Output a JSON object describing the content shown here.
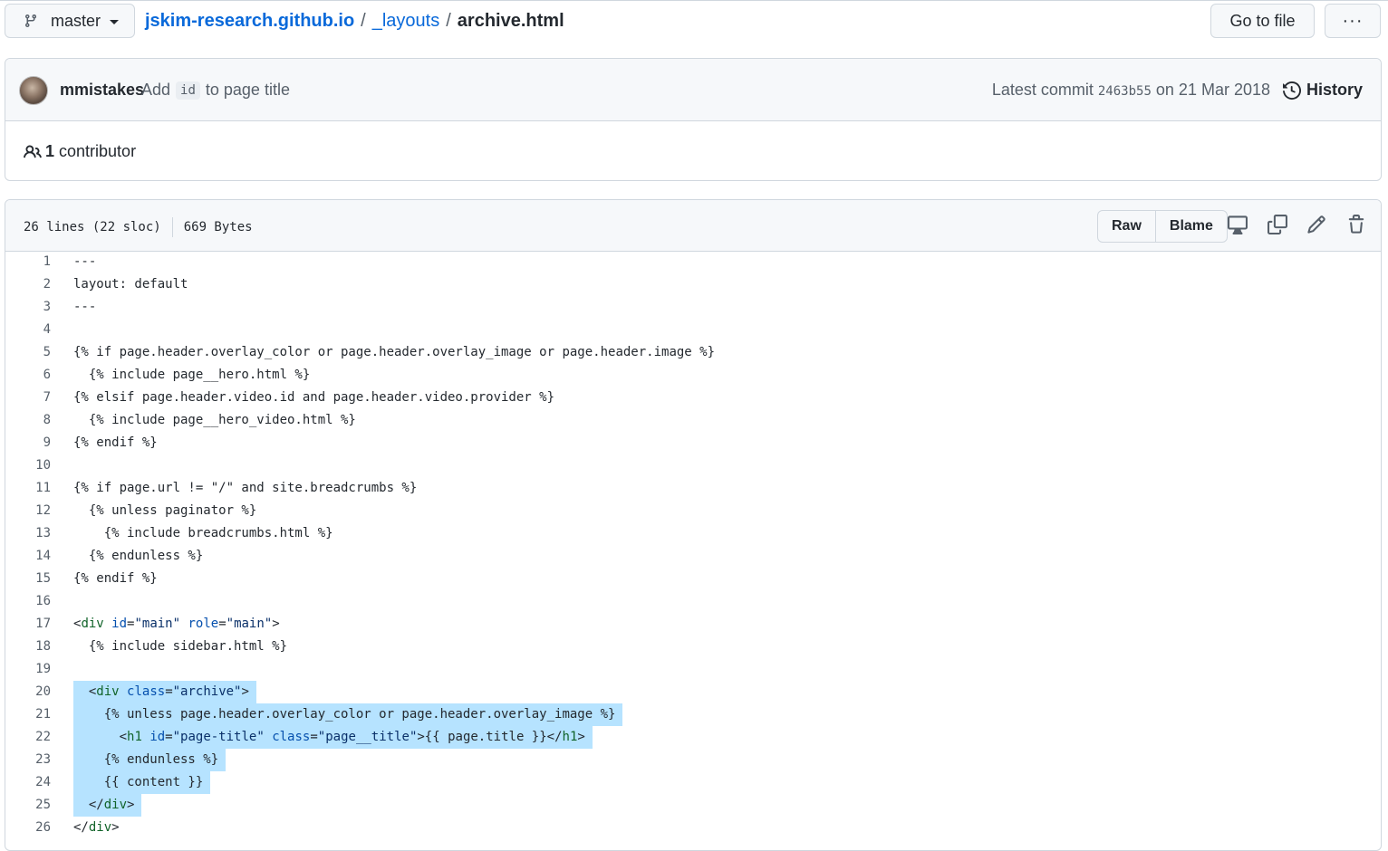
{
  "branch": {
    "label": "master"
  },
  "breadcrumb": {
    "repo": "jskim-research.github.io",
    "sep": "/",
    "dir": "_layouts",
    "file": "archive.html"
  },
  "header_buttons": {
    "goto_file": "Go to file",
    "more": "···"
  },
  "commit": {
    "author": "mmistakes",
    "message_before": "Add",
    "message_code": "id",
    "message_after": "to page title",
    "latest_prefix": "Latest commit",
    "sha": "2463b55",
    "date_text": "on 21 Mar 2018",
    "history_label": "History"
  },
  "contributors": {
    "count": "1",
    "label": "contributor"
  },
  "file": {
    "lines_info": "26 lines (22 sloc)",
    "size": "669 Bytes",
    "raw_label": "Raw",
    "blame_label": "Blame"
  },
  "selection": {
    "first_line": 20,
    "last_line": 25
  },
  "code_lines": [
    "---",
    "layout: default",
    "---",
    "",
    "{% if page.header.overlay_color or page.header.overlay_image or page.header.image %}",
    "  {% include page__hero.html %}",
    "{% elsif page.header.video.id and page.header.video.provider %}",
    "  {% include page__hero_video.html %}",
    "{% endif %}",
    "",
    "{% if page.url != \"/\" and site.breadcrumbs %}",
    "  {% unless paginator %}",
    "    {% include breadcrumbs.html %}",
    "  {% endunless %}",
    "{% endif %}",
    "",
    "<div id=\"main\" role=\"main\">",
    "  {% include sidebar.html %}",
    "",
    "  <div class=\"archive\">",
    "    {% unless page.header.overlay_color or page.header.overlay_image %}",
    "      <h1 id=\"page-title\" class=\"page__title\">{{ page.title }}</h1>",
    "    {% endunless %}",
    "    {{ content }}",
    "  </div>",
    "</div>"
  ],
  "icons": {
    "branch": "git-branch-icon",
    "history": "history-icon",
    "people": "people-icon",
    "display": "display-icon",
    "copy": "copy-icon",
    "edit": "pencil-icon",
    "delete": "trash-icon"
  },
  "colors": {
    "link": "#0969da",
    "selection": "#b6e3ff",
    "tag": "#116329",
    "attr": "#0550ae",
    "string": "#0a3069"
  }
}
